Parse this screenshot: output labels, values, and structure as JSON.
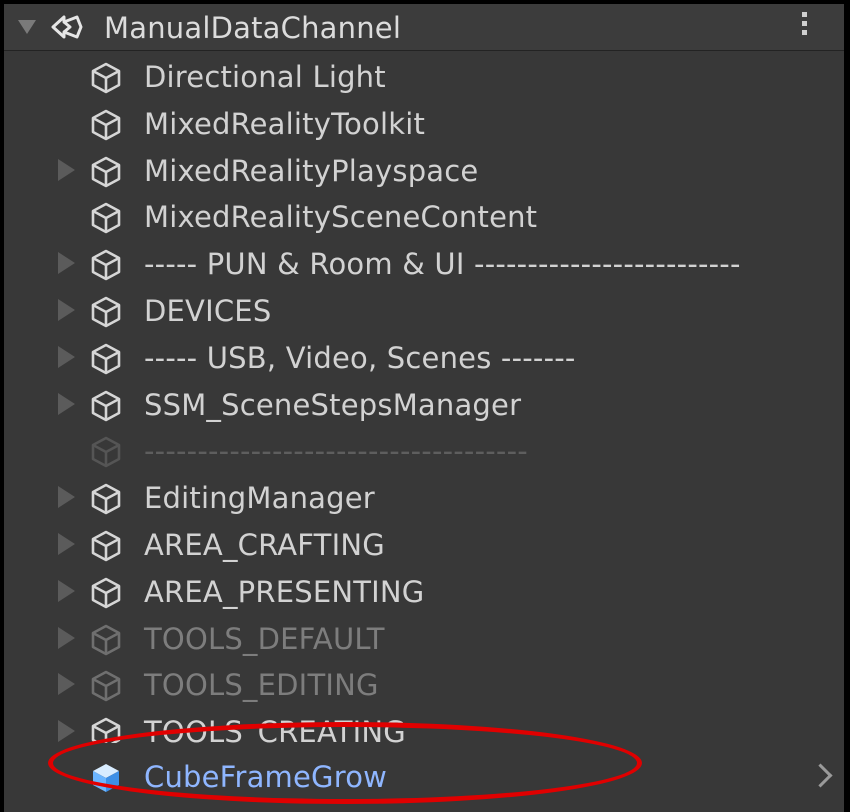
{
  "header": {
    "scene_name": "ManualDataChannel",
    "scene_icon": "unity-scene-icon",
    "menu_icon": "kebab-menu-icon"
  },
  "hierarchy": {
    "items": [
      {
        "label": "Directional Light",
        "has_children": false,
        "state": "normal"
      },
      {
        "label": "MixedRealityToolkit",
        "has_children": false,
        "state": "normal"
      },
      {
        "label": "MixedRealityPlayspace",
        "has_children": true,
        "state": "normal"
      },
      {
        "label": "MixedRealitySceneContent",
        "has_children": false,
        "state": "normal"
      },
      {
        "label": "----- PUN & Room & UI -------------------------",
        "has_children": true,
        "state": "normal"
      },
      {
        "label": "DEVICES",
        "has_children": true,
        "state": "normal"
      },
      {
        "label": "----- USB, Video, Scenes -------",
        "has_children": true,
        "state": "normal"
      },
      {
        "label": "SSM_SceneStepsManager",
        "has_children": true,
        "state": "normal"
      },
      {
        "label": "------------------------------------",
        "has_children": false,
        "state": "faint"
      },
      {
        "label": "EditingManager",
        "has_children": true,
        "state": "normal"
      },
      {
        "label": "AREA_CRAFTING",
        "has_children": true,
        "state": "normal"
      },
      {
        "label": "AREA_PRESENTING",
        "has_children": true,
        "state": "normal"
      },
      {
        "label": "TOOLS_DEFAULT",
        "has_children": true,
        "state": "dim"
      },
      {
        "label": "TOOLS_EDITING",
        "has_children": true,
        "state": "dim"
      },
      {
        "label": "TOOLS_CREATING",
        "has_children": true,
        "state": "clipped"
      }
    ],
    "highlighted_item": {
      "label": "CubeFrameGrow",
      "icon": "prefab-cube-icon",
      "trailing_icon": "chevron-right-icon"
    }
  },
  "colors": {
    "panel_bg": "#383838",
    "text": "#d2d2d2",
    "dim_text": "#7d7d7d",
    "prefab_text": "#8fb6ff",
    "annotation": "#e00000"
  }
}
